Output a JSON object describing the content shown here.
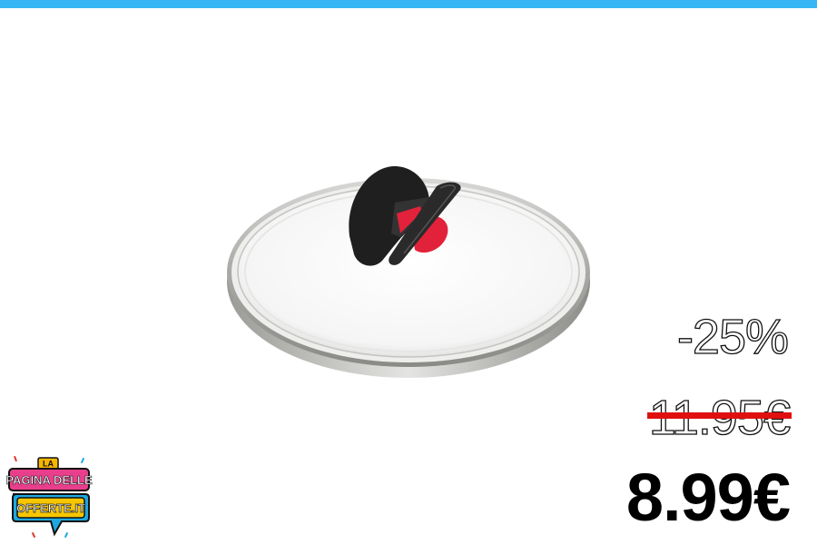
{
  "header": {
    "accent_color": "#37b6f5"
  },
  "product": {
    "image": "glass-lid-with-red-black-knob"
  },
  "pricing": {
    "discount": "-25%",
    "old_price": "11.95€",
    "new_price": "8.99€",
    "strike_color": "#e01010"
  },
  "logo": {
    "line1": "LA",
    "line2": "PAGINA DELLE",
    "line3": "OFFERTE.IT"
  }
}
